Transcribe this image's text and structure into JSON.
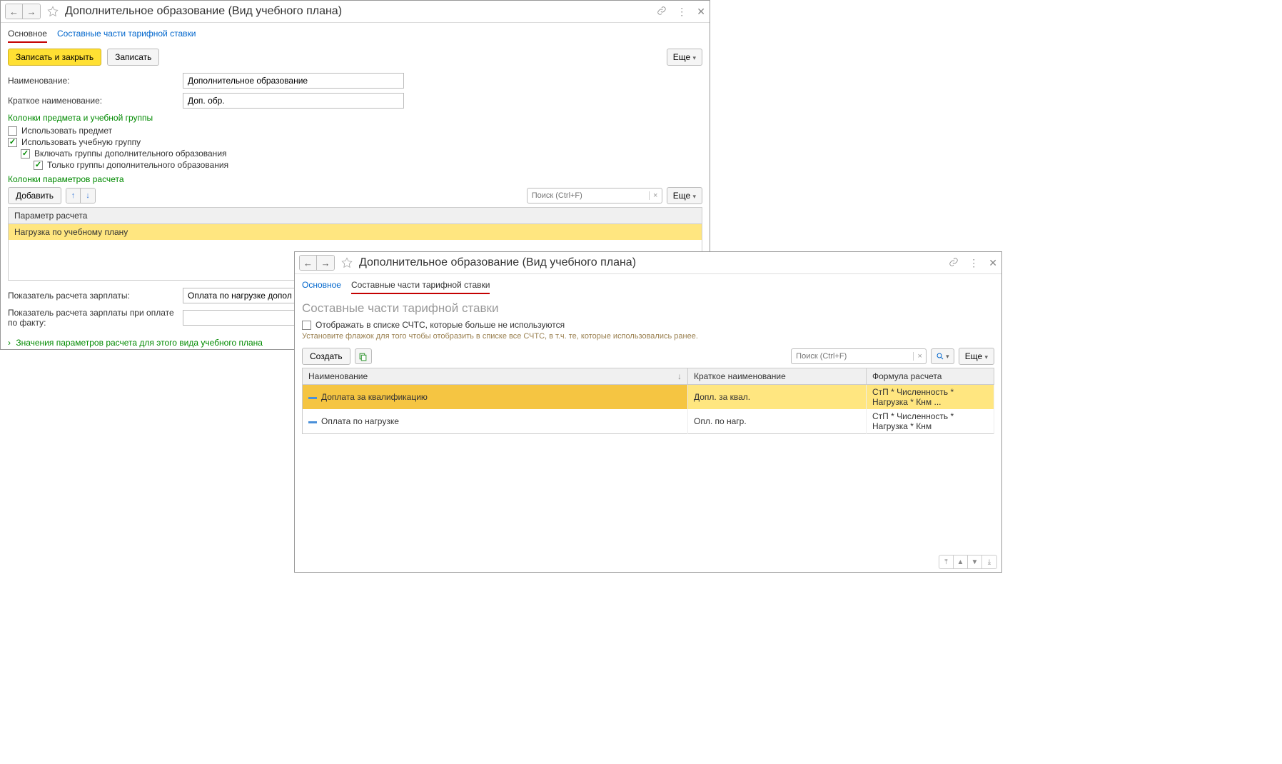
{
  "window1": {
    "title": "Дополнительное образование (Вид учебного плана)",
    "tabs": {
      "main": "Основное",
      "parts": "Составные части тарифной ставки"
    },
    "toolbar": {
      "save_close": "Записать и закрыть",
      "save": "Записать",
      "more": "Еще"
    },
    "form": {
      "name_label": "Наименование:",
      "name_value": "Дополнительное образование",
      "short_label": "Краткое наименование:",
      "short_value": "Доп. обр."
    },
    "section1": {
      "header": "Колонки предмета и учебной группы",
      "use_subject": "Использовать предмет",
      "use_group": "Использовать учебную группу",
      "include_groups": "Включать группы дополнительного образования",
      "only_groups": "Только группы дополнительного образования"
    },
    "section2": {
      "header": "Колонки параметров расчета",
      "add": "Добавить",
      "search_placeholder": "Поиск (Ctrl+F)",
      "more": "Еще",
      "col_header": "Параметр расчета",
      "row1": "Нагрузка по учебному плану"
    },
    "bottom": {
      "indicator_label": "Показатель расчета зарплаты:",
      "indicator_value": "Оплата по нагрузке дополнитель",
      "indicator_fact_label": "Показатель расчета зарплаты при оплате по факту:",
      "expand_link": "Значения параметров расчета для этого вида учебного плана"
    }
  },
  "window2": {
    "title": "Дополнительное образование (Вид учебного плана)",
    "tabs": {
      "main": "Основное",
      "parts": "Составные части тарифной ставки"
    },
    "subtitle": "Составные части тарифной ставки",
    "show_unused": "Отображать в списке СЧТС, которые больше не используются",
    "hint": "Установите флажок для того чтобы отобразить в списке все СЧТС, в т.ч. те, которые использовались ранее.",
    "toolbar": {
      "create": "Создать",
      "search_placeholder": "Поиск (Ctrl+F)",
      "more": "Еще"
    },
    "table": {
      "col_name": "Наименование",
      "col_short": "Краткое наименование",
      "col_formula": "Формула расчета",
      "rows": [
        {
          "name": "Доплата за квалификацию",
          "short": "Допл. за квал.",
          "formula": "СтП * Численность * Нагрузка * Кнм ..."
        },
        {
          "name": "Оплата по нагрузке",
          "short": "Опл. по нагр.",
          "formula": "СтП * Численность * Нагрузка * Кнм"
        }
      ]
    }
  }
}
